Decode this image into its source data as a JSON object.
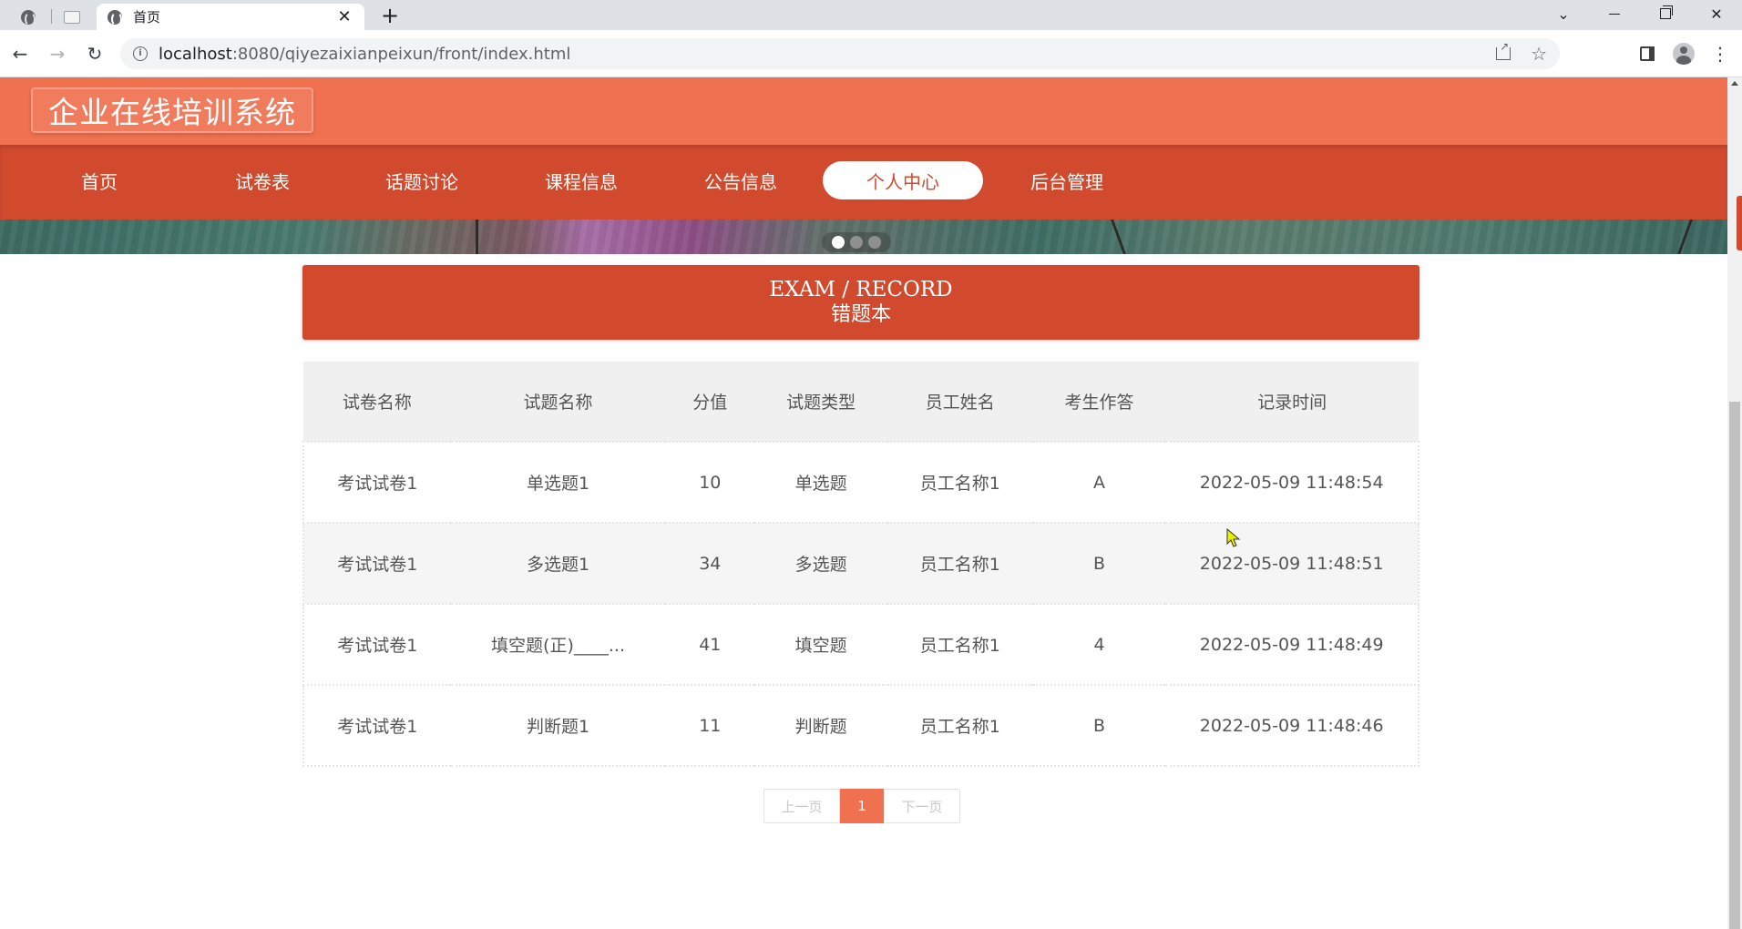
{
  "browser": {
    "tab_title": "首页",
    "url_host": "localhost",
    "url_path": ":8080/qiyezaixianpeixun/front/index.html",
    "icons": [
      "globe-icon",
      "sheet-icon",
      "close-icon",
      "plus-icon",
      "back-icon",
      "forward-icon",
      "reload-icon",
      "info-icon",
      "share-icon",
      "star-icon",
      "extension-icon",
      "profile-icon",
      "kebab-icon"
    ]
  },
  "header": {
    "logo": "企业在线培训系统"
  },
  "nav": {
    "items": [
      {
        "label": "首页"
      },
      {
        "label": "试卷表"
      },
      {
        "label": "话题讨论"
      },
      {
        "label": "课程信息"
      },
      {
        "label": "公告信息"
      },
      {
        "label": "个人中心"
      },
      {
        "label": "后台管理"
      }
    ],
    "active_index": 5
  },
  "section": {
    "title_en": "EXAM / RECORD",
    "title_cn": "错题本"
  },
  "table": {
    "headers": [
      "试卷名称",
      "试题名称",
      "分值",
      "试题类型",
      "员工姓名",
      "考生作答",
      "记录时间"
    ],
    "rows": [
      [
        "考试试卷1",
        "单选题1",
        "10",
        "单选题",
        "员工名称1",
        "A",
        "2022-05-09 11:48:54"
      ],
      [
        "考试试卷1",
        "多选题1",
        "34",
        "多选题",
        "员工名称1",
        "B",
        "2022-05-09 11:48:51"
      ],
      [
        "考试试卷1",
        "填空题(正)____...",
        "41",
        "填空题",
        "员工名称1",
        "4",
        "2022-05-09 11:48:49"
      ],
      [
        "考试试卷1",
        "判断题1",
        "11",
        "判断题",
        "员工名称1",
        "B",
        "2022-05-09 11:48:46"
      ]
    ]
  },
  "pagination": {
    "prev": "上一页",
    "current": "1",
    "next": "下一页"
  },
  "colors": {
    "header_bg": "#f07150",
    "nav_bg": "#d14a2e",
    "accent": "#d14a2e"
  }
}
